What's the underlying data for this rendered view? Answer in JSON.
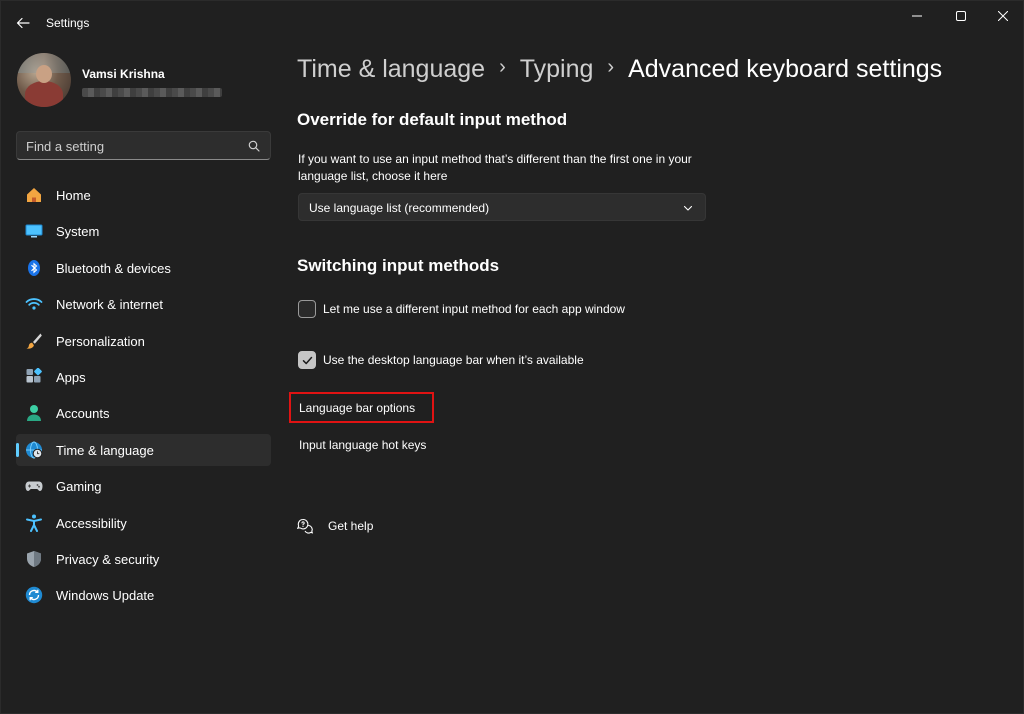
{
  "window": {
    "title": "Settings"
  },
  "profile": {
    "name": "Vamsi Krishna"
  },
  "search": {
    "placeholder": "Find a setting"
  },
  "sidebar": {
    "items": [
      {
        "label": "Home",
        "icon": "home-icon"
      },
      {
        "label": "System",
        "icon": "system-icon"
      },
      {
        "label": "Bluetooth & devices",
        "icon": "bluetooth-icon"
      },
      {
        "label": "Network & internet",
        "icon": "wifi-icon"
      },
      {
        "label": "Personalization",
        "icon": "brush-icon"
      },
      {
        "label": "Apps",
        "icon": "apps-icon"
      },
      {
        "label": "Accounts",
        "icon": "person-icon"
      },
      {
        "label": "Time & language",
        "icon": "globe-clock-icon",
        "active": true
      },
      {
        "label": "Gaming",
        "icon": "gamepad-icon"
      },
      {
        "label": "Accessibility",
        "icon": "accessibility-icon"
      },
      {
        "label": "Privacy & security",
        "icon": "shield-icon"
      },
      {
        "label": "Windows Update",
        "icon": "update-icon"
      }
    ]
  },
  "breadcrumb": {
    "items": [
      "Time & language",
      "Typing",
      "Advanced keyboard settings"
    ],
    "separator": "›"
  },
  "override": {
    "title": "Override for default input method",
    "description": "If you want to use an input method that’s different than the first one in your language list, choose it here",
    "dropdown_value": "Use language list (recommended)"
  },
  "switching": {
    "title": "Switching input methods",
    "options": [
      {
        "label": "Let me use a different input method for each app window",
        "checked": false
      },
      {
        "label": "Use the desktop language bar when it’s available",
        "checked": true
      }
    ]
  },
  "links": {
    "language_bar_options": "Language bar options",
    "input_language_hot_keys": "Input language hot keys"
  },
  "help": {
    "label": "Get help"
  },
  "colors": {
    "background": "#202020",
    "accent": "#60cdff",
    "highlight": "#e01313"
  }
}
